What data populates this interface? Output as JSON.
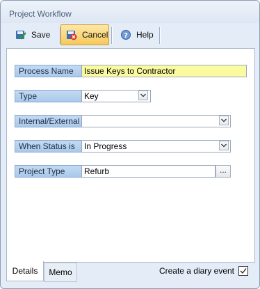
{
  "window": {
    "title": "Project Workflow"
  },
  "toolbar": {
    "save_label": "Save",
    "cancel_label": "Cancel",
    "help_label": "Help"
  },
  "form": {
    "process_name": {
      "label": "Process Name",
      "value": "Issue Keys to Contractor"
    },
    "type": {
      "label": "Type",
      "value": "Key"
    },
    "internal_external": {
      "label": "Internal/External",
      "value": ""
    },
    "when_status_is": {
      "label": "When Status is",
      "value": "In Progress"
    },
    "project_type": {
      "label": "Project Type",
      "value": "Refurb",
      "browse_label": "..."
    }
  },
  "tabs": {
    "details": "Details",
    "memo": "Memo"
  },
  "diary": {
    "label": "Create a diary event",
    "checked": true
  },
  "colors": {
    "highlight_field": "#fafaa0",
    "label_bg": "#b6d1ee",
    "cancel_hover": "#f6c95a"
  }
}
